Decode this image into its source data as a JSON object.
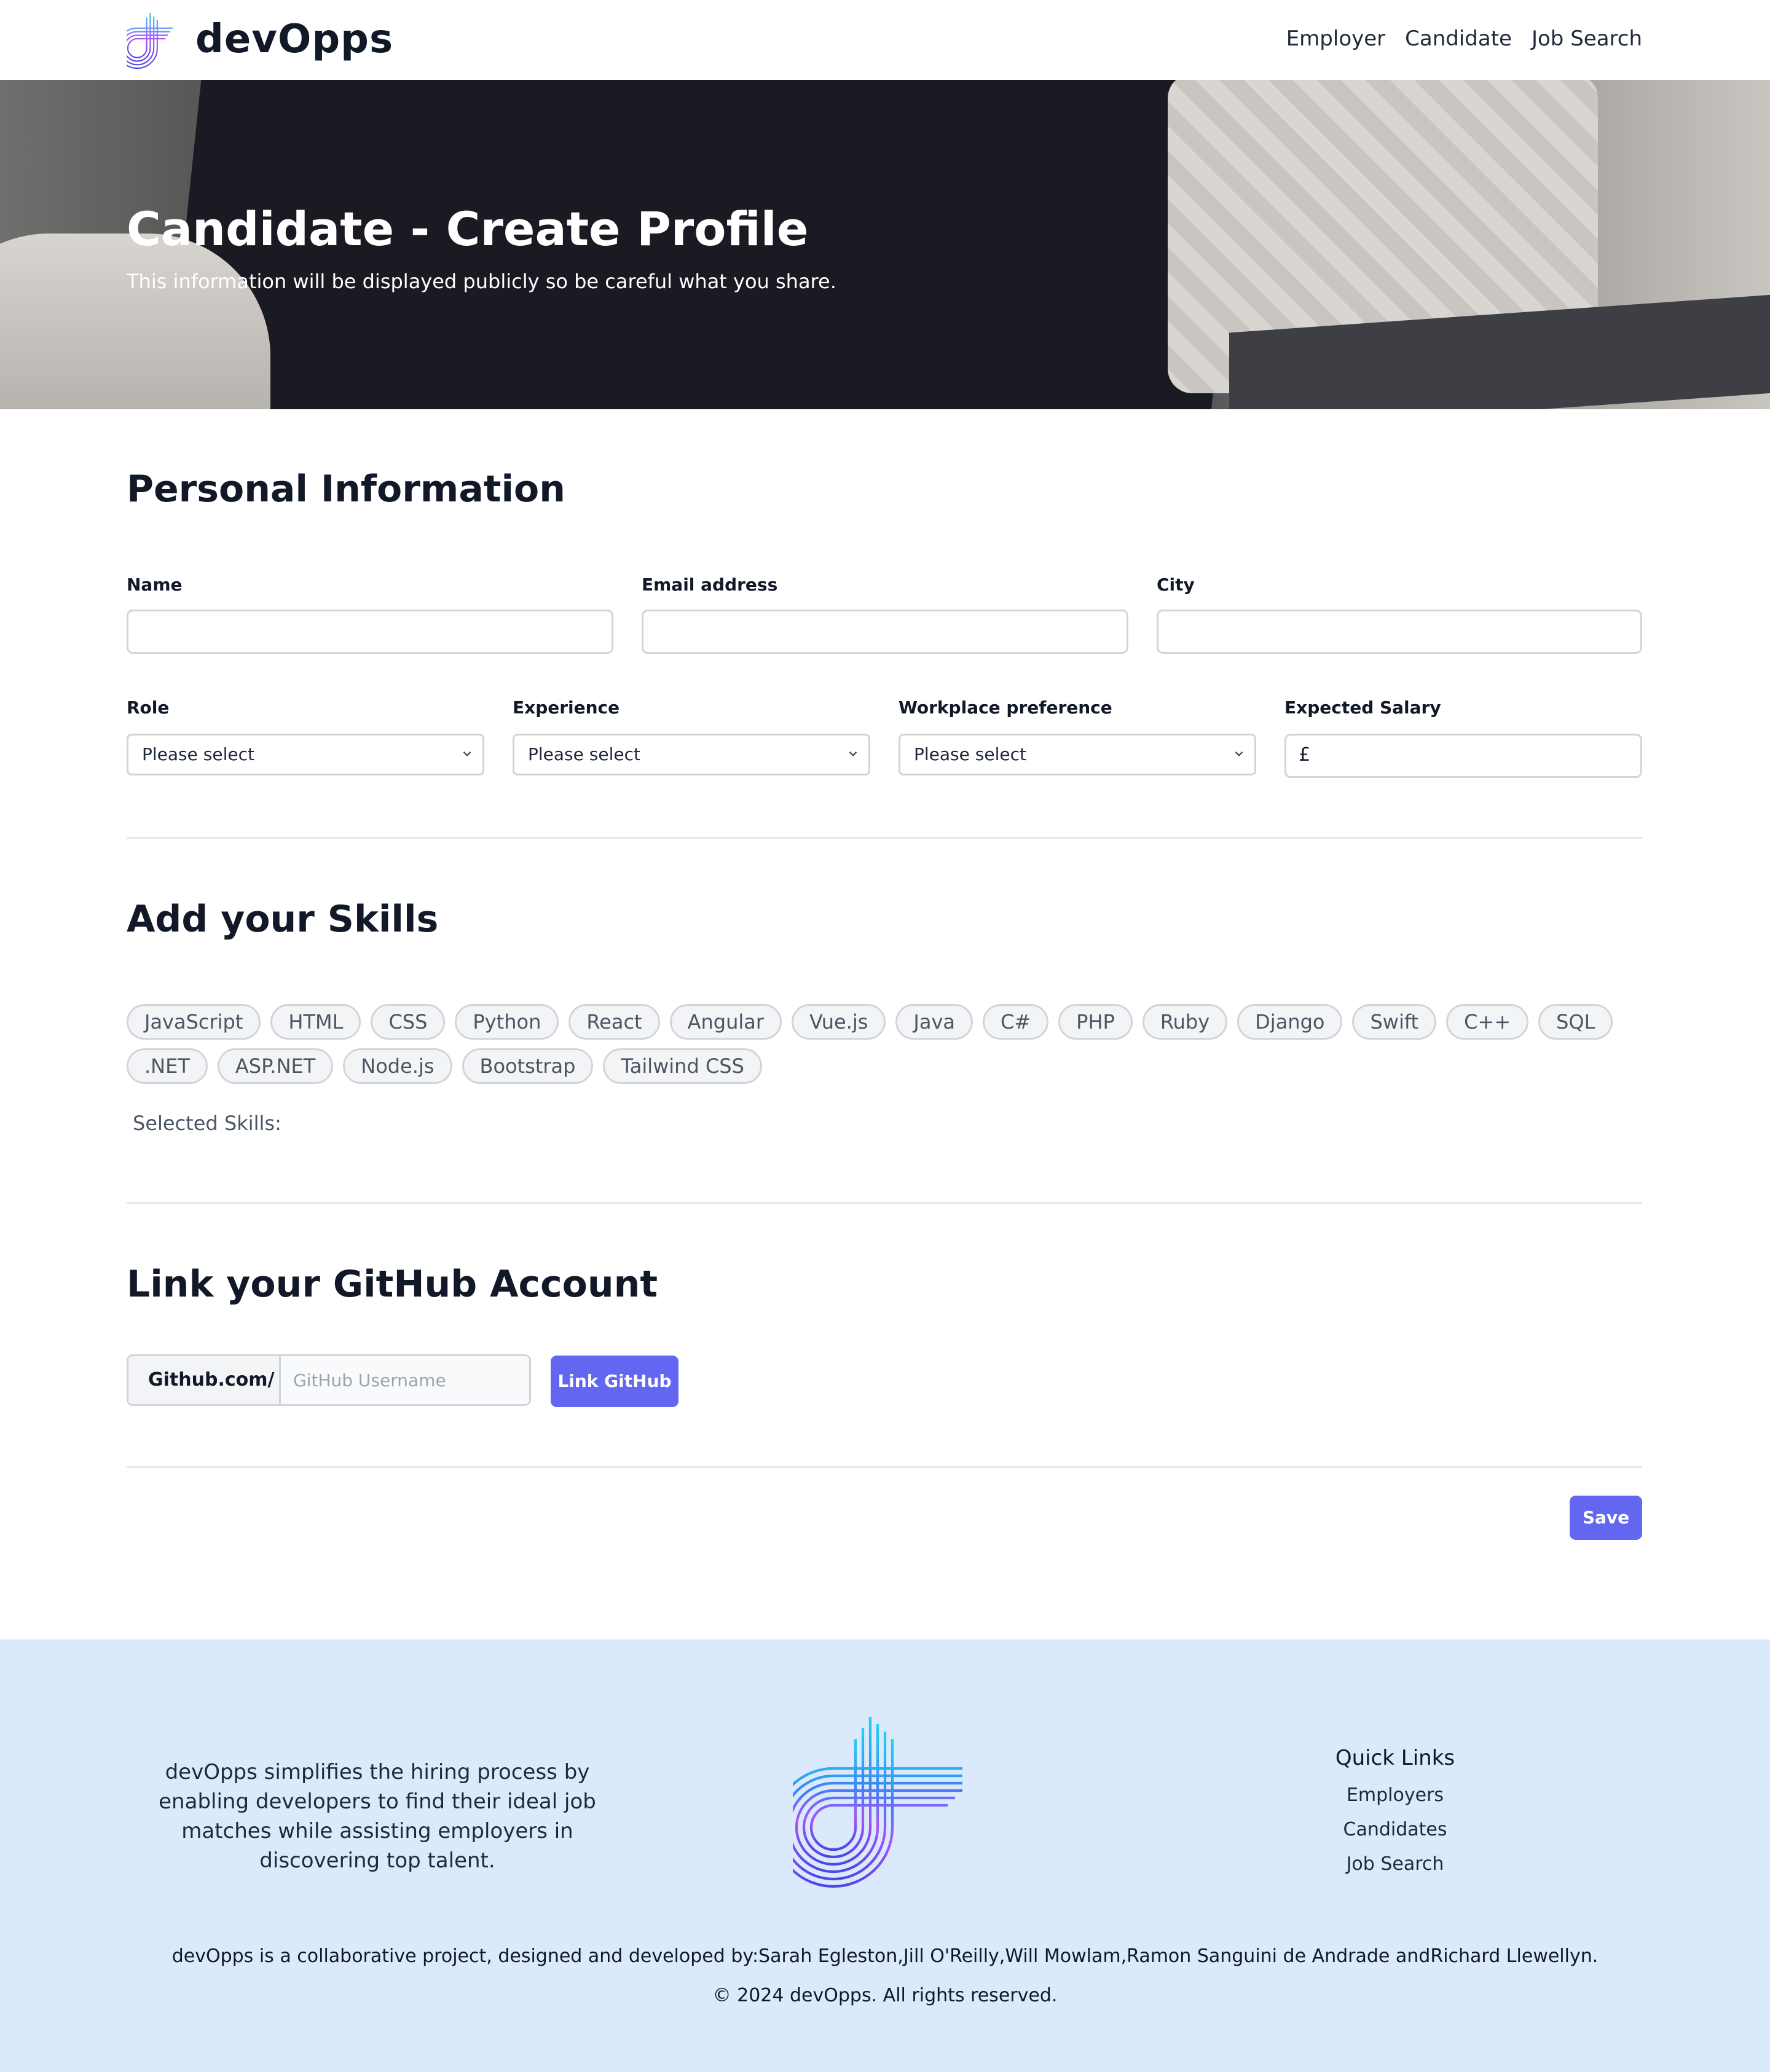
{
  "header": {
    "brand": "devOpps",
    "nav": [
      "Employer",
      "Candidate",
      "Job Search"
    ]
  },
  "hero": {
    "title": "Candidate - Create Profile",
    "subtitle": "This information will be displayed publicly so be careful what you share."
  },
  "personal": {
    "heading": "Personal Information",
    "name_label": "Name",
    "email_label": "Email address",
    "city_label": "City",
    "role_label": "Role",
    "role_value": "Please select",
    "experience_label": "Experience",
    "experience_value": "Please select",
    "workplace_label": "Workplace preference",
    "workplace_value": "Please select",
    "salary_label": "Expected Salary",
    "salary_prefix": "£"
  },
  "skills": {
    "heading": "Add your Skills",
    "items": [
      "JavaScript",
      "HTML",
      "CSS",
      "Python",
      "React",
      "Angular",
      "Vue.js",
      "Java",
      "C#",
      "PHP",
      "Ruby",
      "Django",
      "Swift",
      "C++",
      "SQL",
      ".NET",
      "ASP.NET",
      "Node.js",
      "Bootstrap",
      "Tailwind CSS"
    ],
    "selected_label": "Selected Skills:"
  },
  "github": {
    "heading": "Link your GitHub Account",
    "prefix": "Github.com/",
    "placeholder": "GitHub Username",
    "button": "Link GitHub"
  },
  "actions": {
    "save": "Save"
  },
  "footer": {
    "about": "devOpps simplifies the hiring process by enabling developers to find their ideal job matches while assisting employers in discovering top talent.",
    "quick_links_title": "Quick Links",
    "quick_links": [
      "Employers",
      "Candidates",
      "Job Search"
    ],
    "credits": "devOpps is a collaborative project, designed and developed by:Sarah Egleston,Jill O'Reilly,Will Mowlam,Ramon Sanguini de Andrade andRichard Llewellyn.",
    "copyright": "© 2024 devOpps. All rights reserved."
  },
  "colors": {
    "accent": "#6366f1",
    "footer_bg": "#dbe9fd",
    "border": "#d1d5db"
  },
  "icons": [
    "brand-logo-icon",
    "chevron-down-icon"
  ]
}
